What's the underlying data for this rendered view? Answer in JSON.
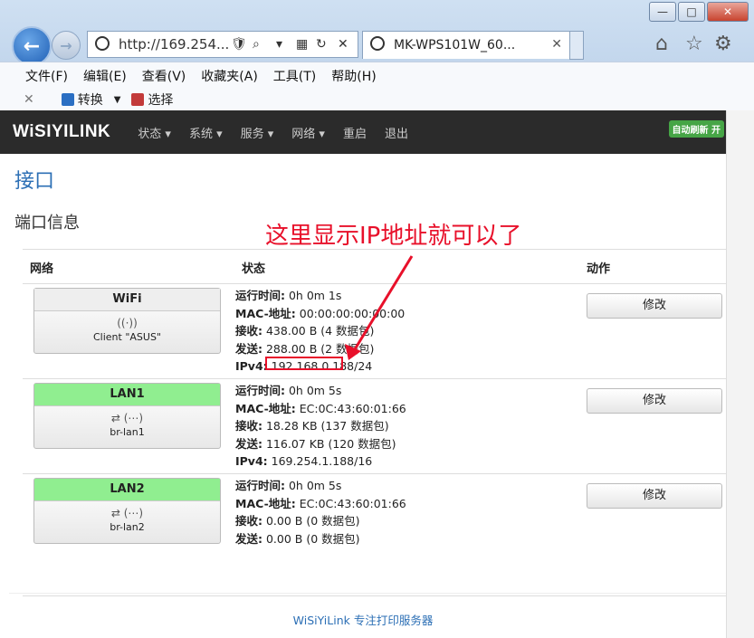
{
  "browser": {
    "url": "http://169.254...",
    "tab_title": "MK-WPS101W_60...",
    "menu": [
      "文件(F)",
      "编辑(E)",
      "查看(V)",
      "收藏夹(A)",
      "工具(T)",
      "帮助(H)"
    ],
    "cmd_convert": "转换",
    "cmd_select": "选择"
  },
  "site": {
    "logo": "WiSIYILINK",
    "nav": [
      "状态 ▾",
      "系统 ▾",
      "服务 ▾",
      "网络 ▾",
      "重启",
      "退出"
    ],
    "auto_refresh": "自动刷新 开"
  },
  "page": {
    "title": "接口",
    "section": "端口信息",
    "annotation": "这里显示IP地址就可以了",
    "columns": {
      "network": "网络",
      "status": "状态",
      "action": "动作"
    },
    "footer": "WiSiYiLink 专注打印服务器"
  },
  "interfaces": [
    {
      "name": "WiFi",
      "sub": "Client \"ASUS\"",
      "header_color": "#eeeeee",
      "labels": [
        "运行时间:",
        "MAC-地址:",
        "接收:",
        "发送:",
        "IPv4:"
      ],
      "values": [
        "0h 0m 1s",
        "00:00:00:00:00:00",
        "438.00 B (4 数据包)",
        "288.00 B (2 数据包)",
        "192.168.0.188/24"
      ],
      "button": "修改"
    },
    {
      "name": "LAN1",
      "sub": "br-lan1",
      "header_color": "#90ee90",
      "labels": [
        "运行时间:",
        "MAC-地址:",
        "接收:",
        "发送:",
        "IPv4:"
      ],
      "values": [
        "0h 0m 5s",
        "EC:0C:43:60:01:66",
        "18.28 KB (137 数据包)",
        "116.07 KB (120 数据包)",
        "169.254.1.188/16"
      ],
      "button": "修改"
    },
    {
      "name": "LAN2",
      "sub": "br-lan2",
      "header_color": "#90ee90",
      "labels": [
        "运行时间:",
        "MAC-地址:",
        "接收:",
        "发送:"
      ],
      "values": [
        "0h 0m 5s",
        "EC:0C:43:60:01:66",
        "0.00 B (0 数据包)",
        "0.00 B (0 数据包)"
      ],
      "button": "修改"
    }
  ]
}
